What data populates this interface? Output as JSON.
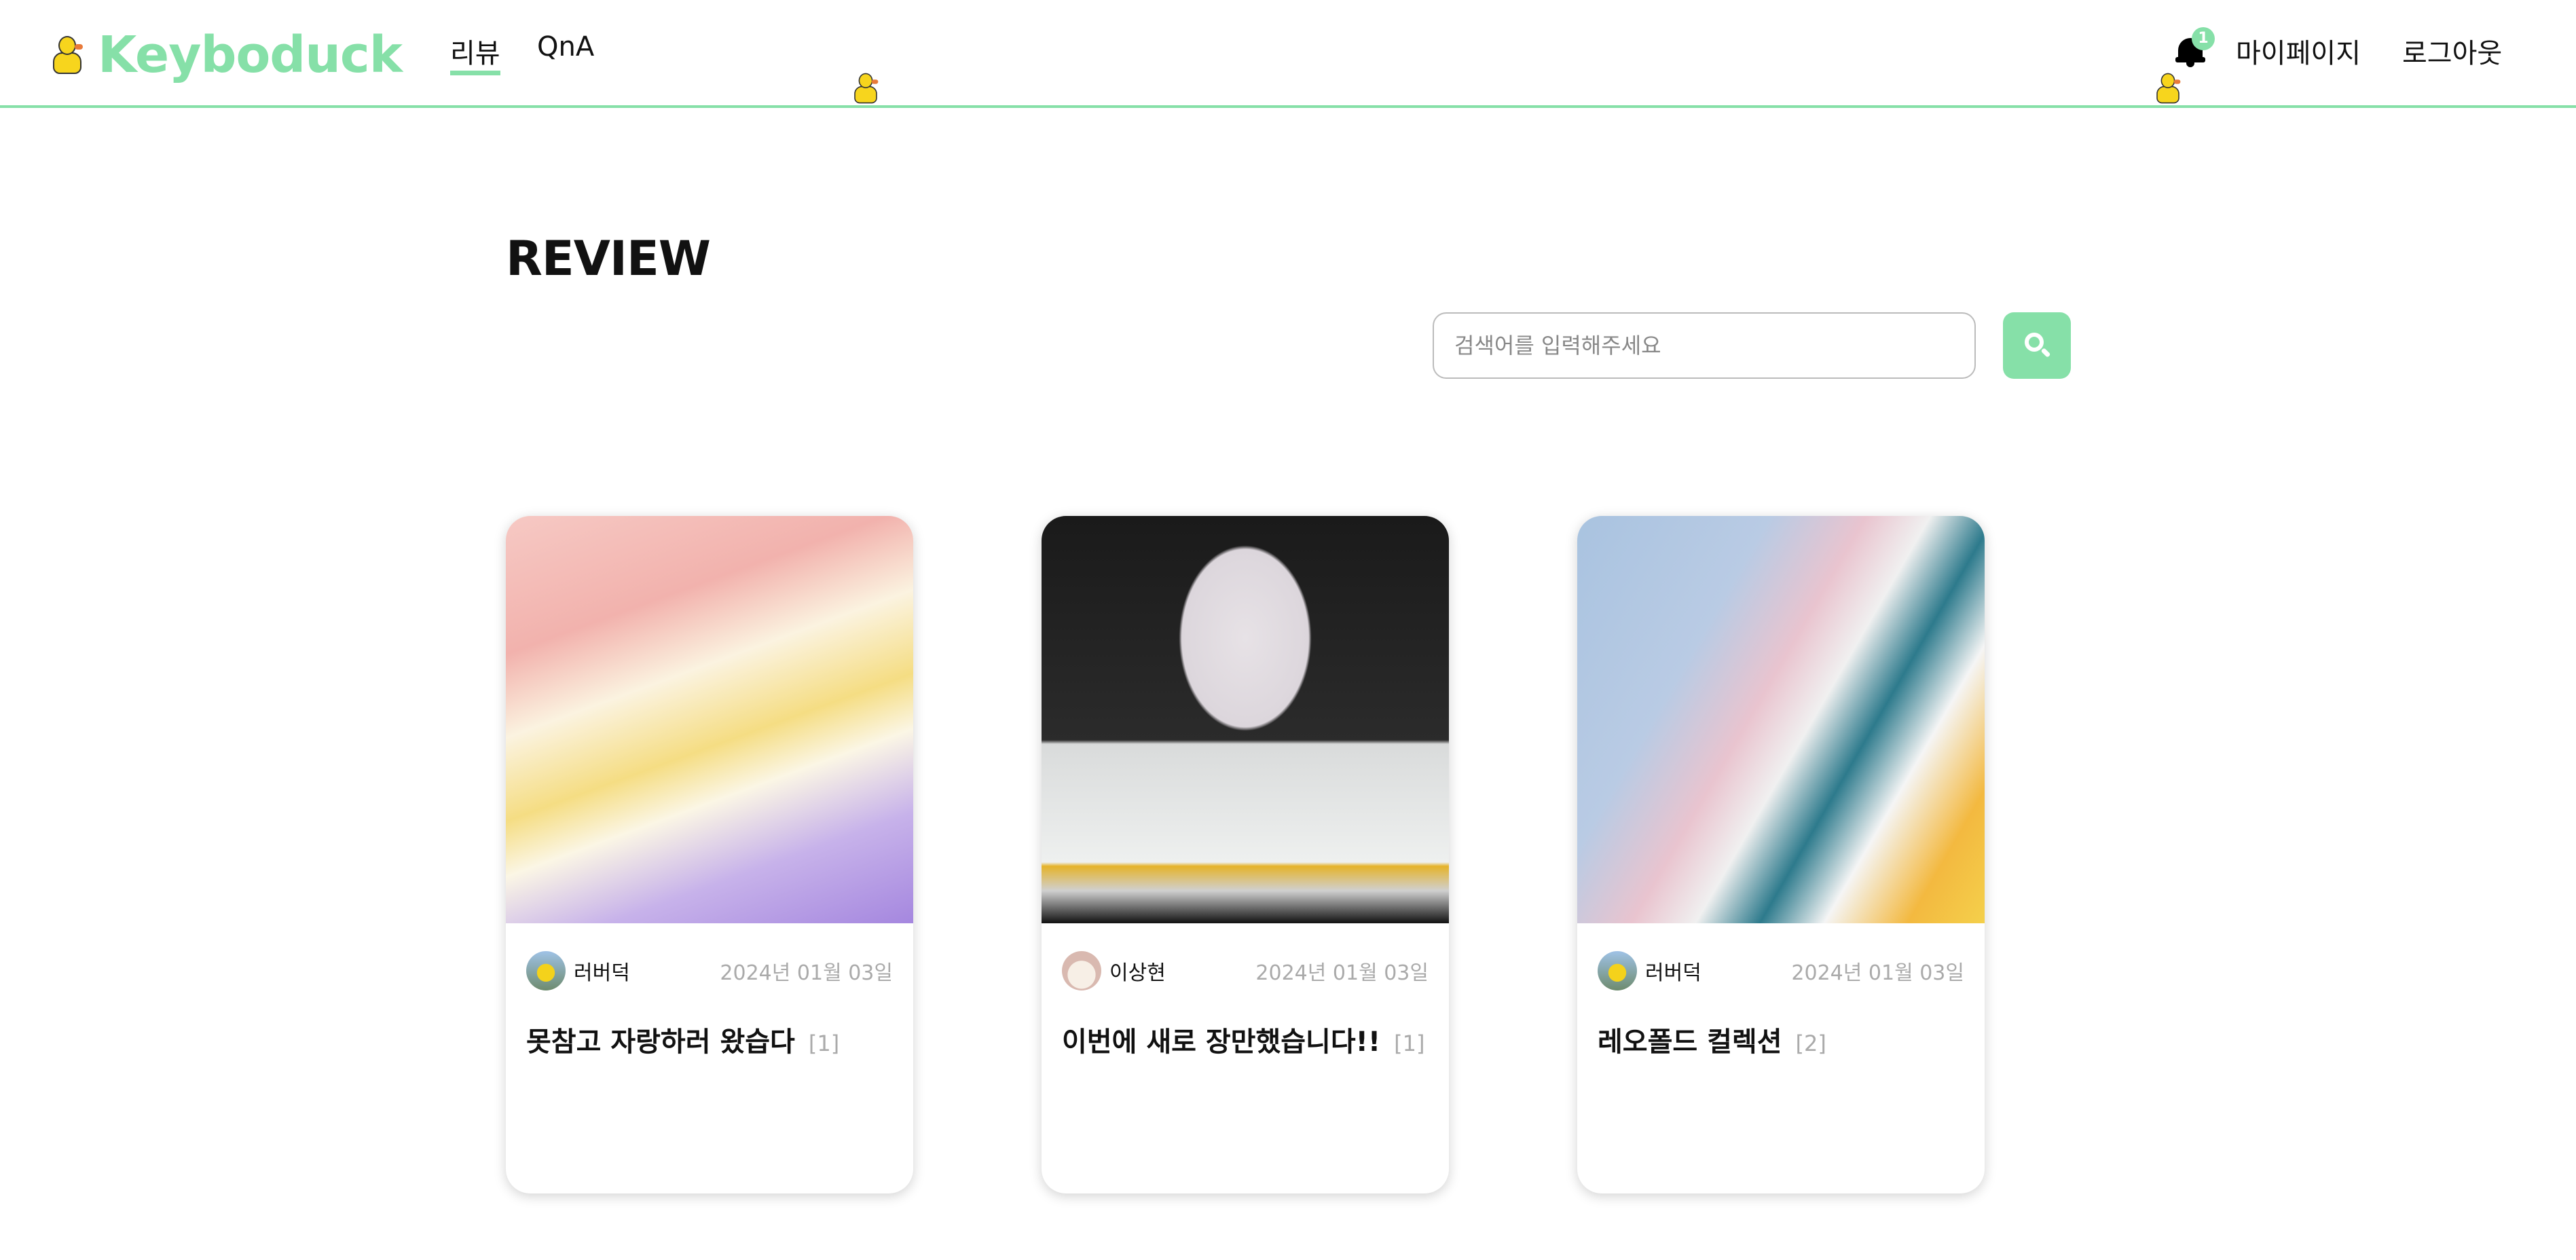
{
  "header": {
    "logo_text": "Keyboduck",
    "nav": [
      {
        "label": "리뷰",
        "active": true
      },
      {
        "label": "QnA",
        "active": false
      }
    ],
    "notification_count": "1",
    "mypage_label": "마이페이지",
    "logout_label": "로그아웃",
    "accent_color": "#86e0a8"
  },
  "page": {
    "title": "REVIEW",
    "search": {
      "placeholder": "검색어를 입력해주세요",
      "value": ""
    }
  },
  "cards": [
    {
      "author": "러버덕",
      "date": "2024년 01월 03일",
      "title": "못참고 자랑하러 왔습다",
      "count": "[1]"
    },
    {
      "author": "이상현",
      "date": "2024년 01월 03일",
      "title": "이번에 새로 장만했습니다!!",
      "count": "[1]"
    },
    {
      "author": "러버덕",
      "date": "2024년 01월 03일",
      "title": "레오폴드 컬렉션",
      "count": "[2]"
    }
  ]
}
